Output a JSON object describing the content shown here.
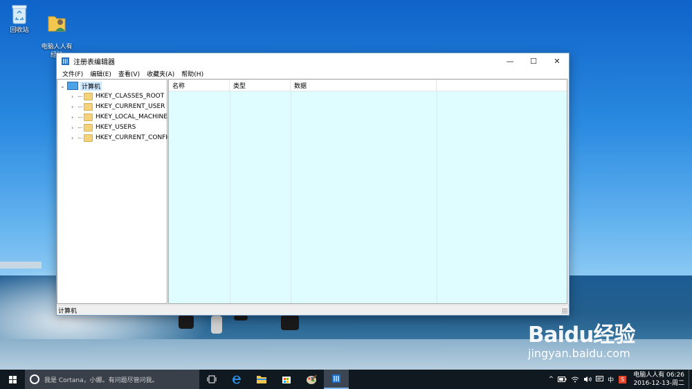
{
  "desktop": {
    "icons": [
      {
        "label": "回收站",
        "icon": "recycle-bin-icon"
      },
      {
        "label": "电脑人人有\n经验",
        "icon": "user-folder-icon"
      }
    ]
  },
  "window": {
    "title": "注册表编辑器",
    "controls": {
      "minimize": "—",
      "maximize": "☐",
      "close": "✕"
    },
    "menu": [
      "文件(F)",
      "编辑(E)",
      "查看(V)",
      "收藏夹(A)",
      "帮助(H)"
    ],
    "tree": {
      "root": "计算机",
      "children": [
        "HKEY_CLASSES_ROOT",
        "HKEY_CURRENT_USER",
        "HKEY_LOCAL_MACHINE",
        "HKEY_USERS",
        "HKEY_CURRENT_CONFIG"
      ]
    },
    "columns": [
      "名称",
      "类型",
      "数据"
    ],
    "status": "计算机"
  },
  "taskbar": {
    "cortana_placeholder": "我是 Cortana，小娜。有问题尽管问我。",
    "tray": {
      "chevron": "^",
      "input_method": "中",
      "ime_brand": "S",
      "clock_line1": "电脑人人有 06:26",
      "clock_line2": "2016-12-13-周二"
    }
  },
  "watermark": {
    "logo": "Baidu经验",
    "url": "jingyan.baidu.com"
  },
  "colors": {
    "values_pane_bg": "#dffdff",
    "taskbar_bg": "#101820",
    "selection": "#cce8ff"
  }
}
